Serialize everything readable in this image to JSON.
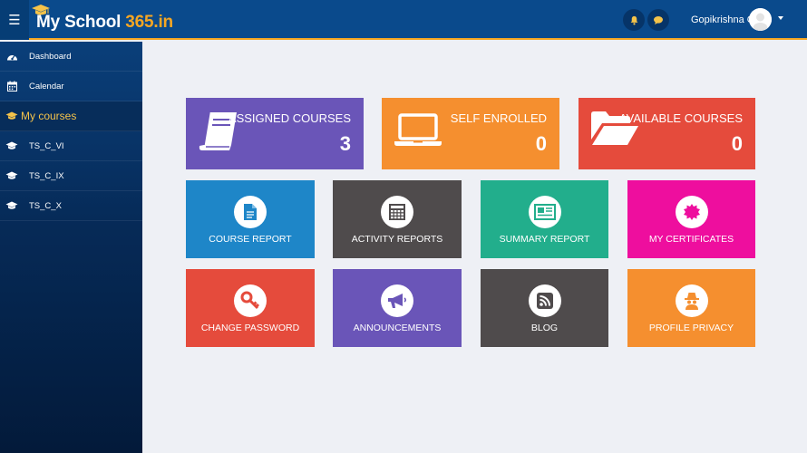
{
  "header": {
    "logo": {
      "part1": "My School ",
      "part2": "365.in"
    },
    "user_name": "Gopikrishna G"
  },
  "sidebar": {
    "items": [
      {
        "label": "Dashboard",
        "icon": "dashboard-icon"
      },
      {
        "label": "Calendar",
        "icon": "calendar-icon"
      }
    ],
    "section": {
      "label": "My courses",
      "icon": "graduation-cap-icon"
    },
    "courses": [
      {
        "label": "TS_C_VI",
        "icon": "graduation-cap-icon"
      },
      {
        "label": "TS_C_IX",
        "icon": "graduation-cap-icon"
      },
      {
        "label": "TS_C_X",
        "icon": "graduation-cap-icon"
      }
    ]
  },
  "summary_tiles": [
    {
      "title": "ASSIGNED COURSES",
      "count": "3",
      "color": "#6a55b8",
      "icon": "book-icon"
    },
    {
      "title": "SELF ENROLLED",
      "count": "0",
      "color": "#f58f2f",
      "icon": "laptop-icon"
    },
    {
      "title": "AVAILABLE COURSES",
      "count": "0",
      "color": "#e54b3c",
      "icon": "folder-open-icon"
    }
  ],
  "action_tiles": [
    {
      "label": "COURSE REPORT",
      "color": "#1e86c8",
      "icon": "document-icon"
    },
    {
      "label": "ACTIVITY REPORTS",
      "color": "#4f4b4c",
      "icon": "calculator-icon"
    },
    {
      "label": "SUMMARY REPORT",
      "color": "#22ae8c",
      "icon": "newspaper-icon"
    },
    {
      "label": "MY CERTIFICATES",
      "color": "#ee0e9e",
      "icon": "certificate-icon"
    },
    {
      "label": "CHANGE PASSWORD",
      "color": "#e54b3c",
      "icon": "key-icon"
    },
    {
      "label": "ANNOUNCEMENTS",
      "color": "#6a55b8",
      "icon": "megaphone-icon"
    },
    {
      "label": "BLOG",
      "color": "#4f4b4c",
      "icon": "rss-icon"
    },
    {
      "label": "PROFILE PRIVACY",
      "color": "#f58f2f",
      "icon": "incognito-icon"
    }
  ],
  "colors": {
    "header": "#0a4a8c",
    "accent": "#f5a623",
    "content_bg": "#eef0f5"
  }
}
